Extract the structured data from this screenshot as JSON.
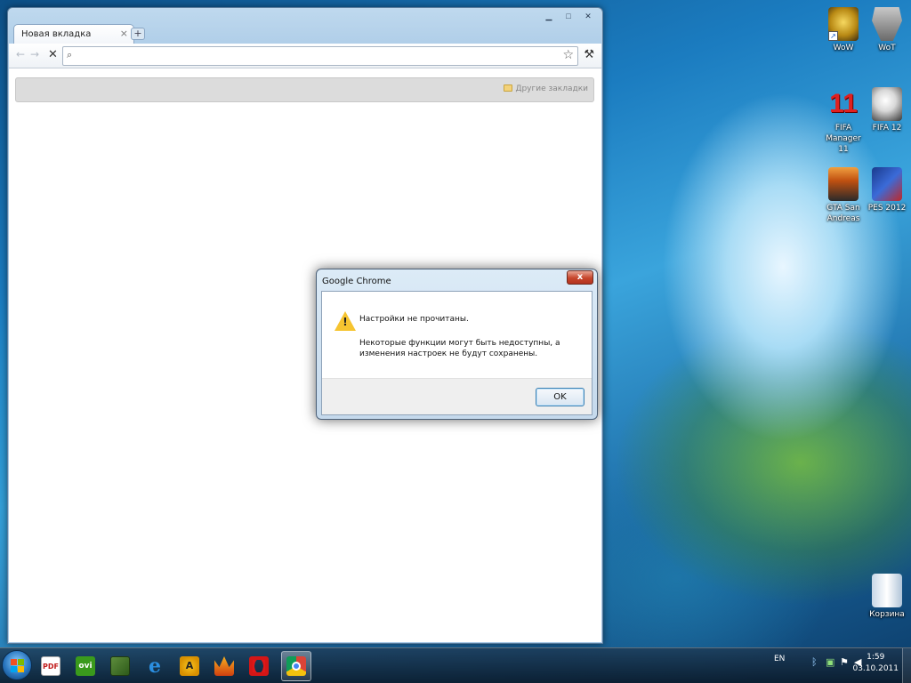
{
  "desktop": {
    "icons": [
      {
        "label": "WoW"
      },
      {
        "label": "WoT"
      },
      {
        "label": "FIFA Manager 11",
        "pic_text": "11"
      },
      {
        "label": "FIFA 12"
      },
      {
        "label": "GTA San Andreas"
      },
      {
        "label": "PES 2012"
      },
      {
        "label": "Корзина"
      }
    ],
    "shortcut_arrow": "↗"
  },
  "browser": {
    "tab_title": "Новая вкладка",
    "tab_close": "×",
    "new_tab": "+",
    "window_controls": {
      "minimize": "▁",
      "maximize": "□",
      "close": "✕"
    },
    "back_glyph": "←",
    "forward_glyph": "→",
    "stop_glyph": "✕",
    "address_value": "",
    "search_glyph": "🔍",
    "star_glyph": "☆",
    "wrench_glyph": "🔧",
    "other_bookmarks": "Другие закладки"
  },
  "dialog": {
    "title": "Google Chrome",
    "close_glyph": "x",
    "warning_glyph": "!",
    "message": "Настройки не прочитаны.",
    "detail": "Некоторые функции могут быть недоступны, а изменения настроек не будут сохранены.",
    "ok_label": "OK"
  },
  "taskbar": {
    "apps": [
      {
        "name": "pdf-reader",
        "text": "PDF"
      },
      {
        "name": "ovi",
        "text": "ovi"
      },
      {
        "name": "screen-tool",
        "text": ""
      },
      {
        "name": "internet-explorer",
        "text": "e"
      },
      {
        "name": "aimp",
        "text": "A"
      },
      {
        "name": "crown-app",
        "text": ""
      },
      {
        "name": "opera",
        "text": ""
      },
      {
        "name": "chrome",
        "text": ""
      }
    ],
    "tray": {
      "language": "EN",
      "time": "1:59",
      "date": "03.10.2011"
    }
  },
  "colors": {
    "dialog_border": "#4b5f76",
    "ok_border": "#3c7fb1",
    "close_red": "#c6452b",
    "warning_yellow": "#f6c430"
  }
}
